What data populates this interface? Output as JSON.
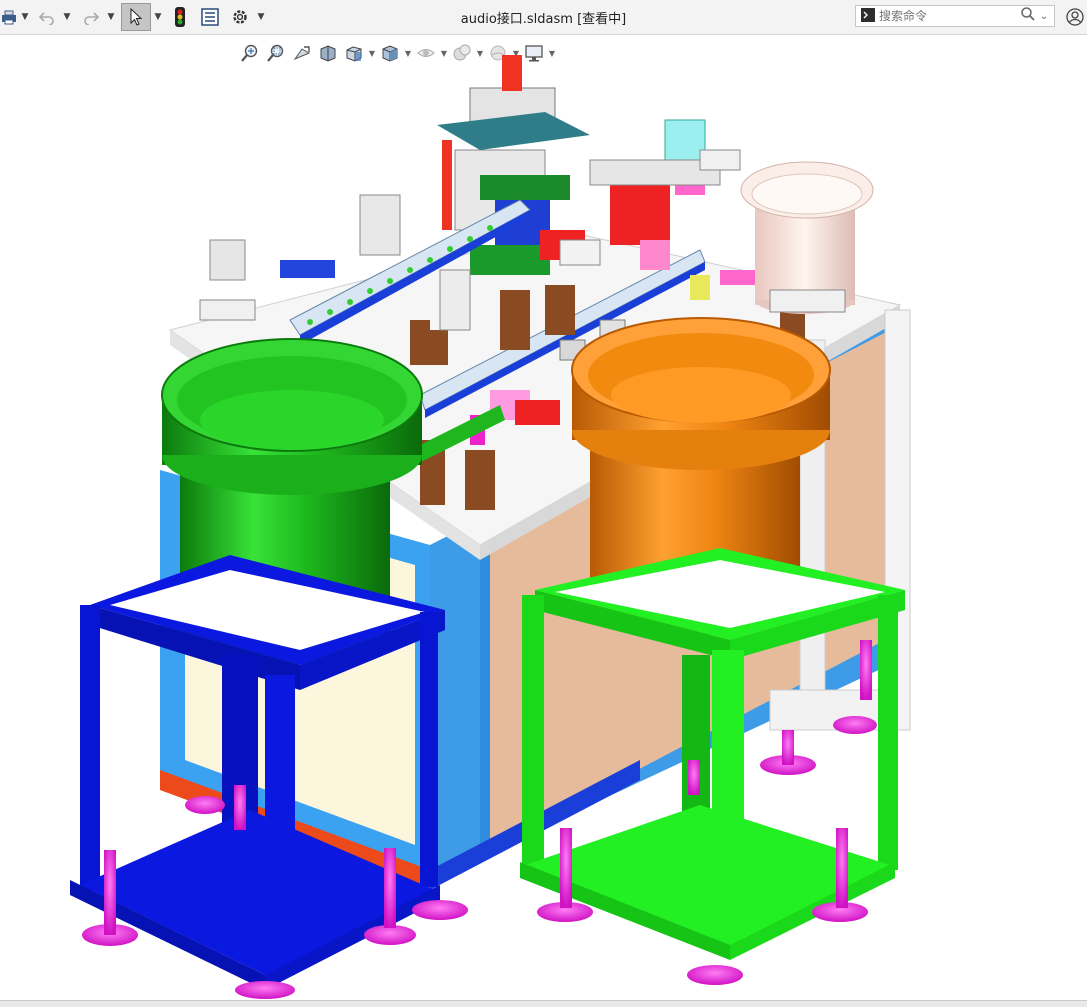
{
  "titlebar": {
    "document_title": "audio接口.sldasm [查看中]",
    "search_placeholder": "搜索命令"
  },
  "toolbar": {
    "icons": [
      "print-icon",
      "undo-icon",
      "redo-icon",
      "select-icon",
      "traffic-light-icon",
      "options-list-icon",
      "gear-icon"
    ]
  },
  "view_toolbar": {
    "icons": [
      "zoom-to-fit-icon",
      "zoom-area-icon",
      "previous-view-icon",
      "section-view-icon",
      "view-orientation-icon",
      "display-style-icon",
      "hide-show-icon",
      "appearance-icon",
      "scene-icon",
      "view-settings-icon"
    ]
  },
  "colors": {
    "green_feeder": "#1ec31e",
    "orange_feeder": "#f28a10",
    "blue_stand": "#0a18e0",
    "green_stand": "#22f022",
    "cabinet_blue": "#3aa2f0",
    "foot_magenta": "#ee22dd"
  }
}
